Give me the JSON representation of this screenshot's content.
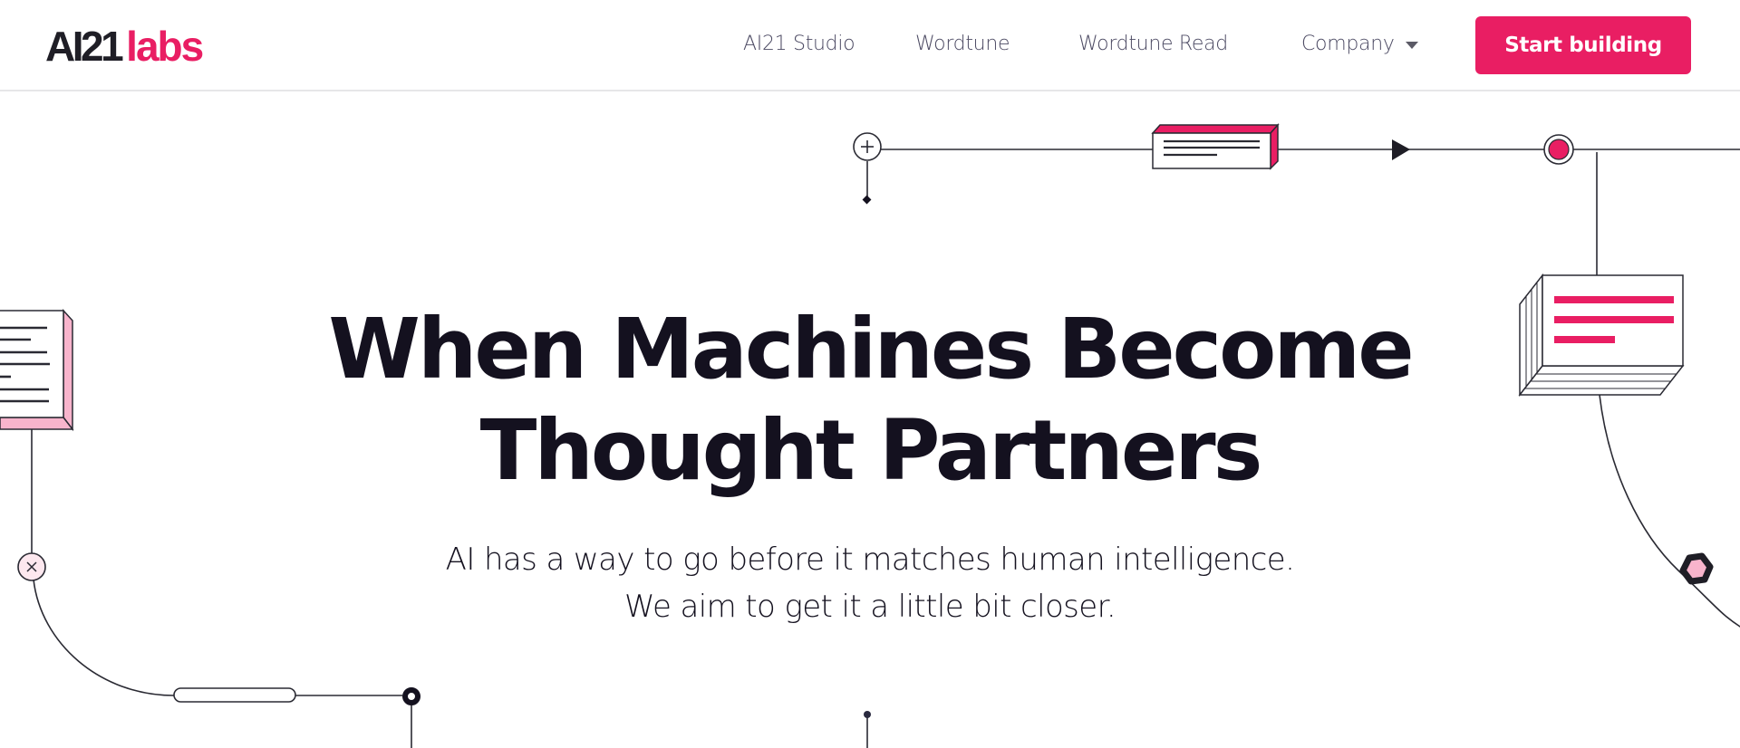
{
  "header": {
    "logo": {
      "primary": "AI21",
      "secondary": "labs"
    },
    "nav": [
      {
        "label": "AI21 Studio"
      },
      {
        "label": "Wordtune"
      },
      {
        "label": "Wordtune Read"
      },
      {
        "label": "Company",
        "has_dropdown": true
      }
    ],
    "cta_label": "Start building"
  },
  "hero": {
    "title_lines": [
      "When Machines Become",
      "Thought Partners"
    ],
    "subtitle_lines": [
      "AI has a way to go before it matches human intelligence.",
      "We aim to get it a little bit closer."
    ]
  },
  "decoration_icons": [
    "plus-circle-icon",
    "diamond-node-icon",
    "document-block-icon",
    "play-arrow-icon",
    "pink-dot-node-icon",
    "stacked-document-icon",
    "hexagon-node-icon",
    "pink-document-icon",
    "x-circle-icon",
    "pill-node-icon",
    "ring-node-icon",
    "dot-node-icon"
  ],
  "colors": {
    "brand_pink": "#e91e63",
    "light_pink": "#f8b4cc",
    "text_dark": "#14111f",
    "nav_text": "#4c4a63",
    "line": "#2a2a33"
  }
}
